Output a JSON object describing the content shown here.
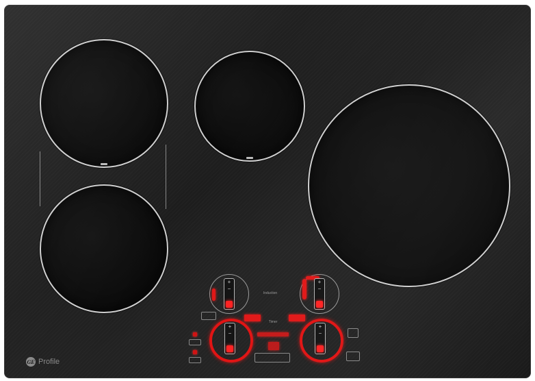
{
  "brand": {
    "logo_text": "GE",
    "name": "Profile"
  },
  "burners": [
    {
      "id": "left-rear"
    },
    {
      "id": "left-front"
    },
    {
      "id": "center-rear"
    },
    {
      "id": "right"
    }
  ],
  "controls": {
    "induction_label": "Induction",
    "timer_label": "Timer",
    "knobs": [
      {
        "id": "left-rear",
        "state": "partial"
      },
      {
        "id": "right-rear",
        "state": "partial"
      },
      {
        "id": "left-front",
        "state": "active"
      },
      {
        "id": "right-front",
        "state": "active"
      }
    ],
    "colors": {
      "accent": "#e01010",
      "glass": "#1e1e1e",
      "ring": "#cfcfcf"
    }
  }
}
